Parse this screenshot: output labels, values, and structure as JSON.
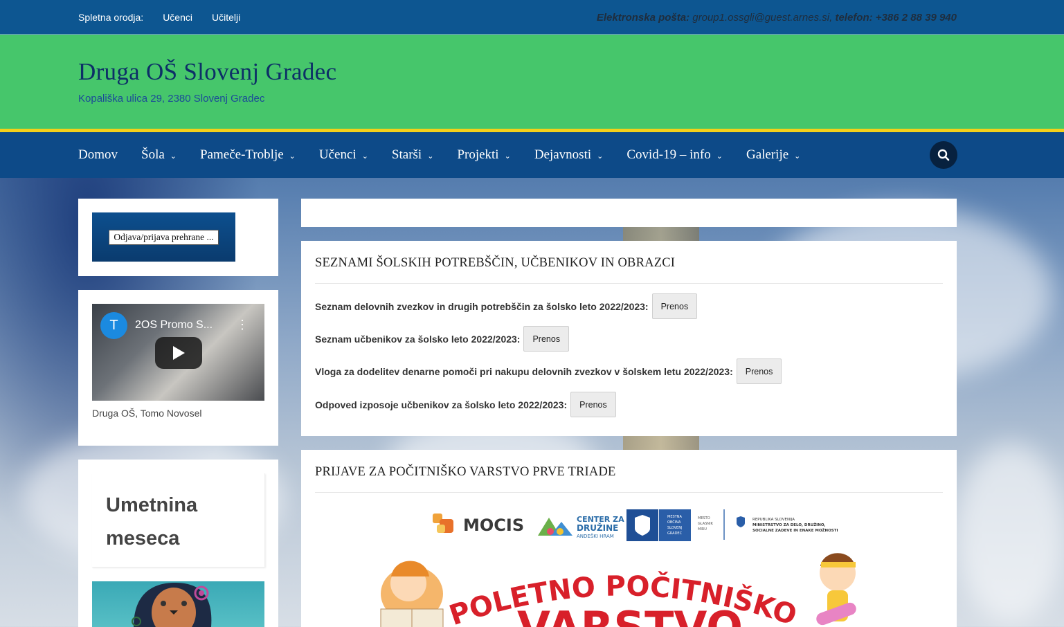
{
  "topbar": {
    "tools_label": "Spletna orodja:",
    "links": [
      "Učenci",
      "Učitelji"
    ],
    "email_label": "Elektronska pošta:",
    "email": "group1.ossgli@guest.arnes.si,",
    "phone_label": "telefon:",
    "phone": "+386 2 88 39 940"
  },
  "header": {
    "title": "Druga OŠ Slovenj Gradec",
    "subtitle": "Kopališka ulica 29, 2380 Slovenj Gradec"
  },
  "nav": {
    "items": [
      "Domov",
      "Šola",
      "Pameče-Troblje",
      "Učenci",
      "Starši",
      "Projekti",
      "Dejavnosti",
      "Covid-19 – info",
      "Galerije"
    ],
    "search_icon": "search-icon"
  },
  "sidebar": {
    "banner_label": "Odjava/prijava prehrane ...",
    "video": {
      "channel_initial": "T",
      "title": "2OS Promo S...",
      "caption": "Druga OŠ, Tomo Novosel"
    },
    "art": {
      "title_line1": "Umetnina",
      "title_line2": "meseca"
    }
  },
  "posts": [
    {
      "title": "SEZNAMI ŠOLSKIH POTREBŠČIN, UČBENIKOV IN OBRAZCI",
      "rows": [
        {
          "label": "Seznam delovnih zvezkov in drugih potrebščin za šolsko leto 2022/2023:",
          "button": "Prenos"
        },
        {
          "label": "Seznam učbenikov za šolsko leto 2022/2023:",
          "button": "Prenos"
        },
        {
          "label": "Vloga za dodelitev denarne pomoči pri nakupu delovnih zvezkov v šolskem letu 2022/2023:",
          "button": "Prenos"
        },
        {
          "label": "Odpoved izposoje učbenikov za šolsko leto 2022/2023:",
          "button": "Prenos"
        }
      ]
    },
    {
      "title": "PRIJAVE ZA POČITNIŠKO VARSTVO PRVE TRIADE",
      "logos": {
        "mocis": "MOCIS",
        "center_l1": "CENTER ZA",
        "center_l2": "DRUŽINE",
        "center_l3": "ANDEŠKI HRAM",
        "mestna_l1": "MESTNA",
        "mestna_l2": "OBČINA",
        "mestna_l3": "SLOVENJ",
        "mestna_l4": "GRADEC",
        "mesto_l1": "MESTO",
        "mesto_l2": "GLASNIK",
        "mesto_l3": "MIRU",
        "rs_l1": "REPUBLIKA SLOVENIJA",
        "rs_l2": "MINISTRSTVO ZA DELO, DRUŽINO,",
        "rs_l3": "SOCIALNE ZADEVE IN ENAKE MOŽNOSTI"
      },
      "poster_line1": "POLETNO POČITNIŠKO",
      "poster_line2": "VARSTVO"
    }
  ]
}
